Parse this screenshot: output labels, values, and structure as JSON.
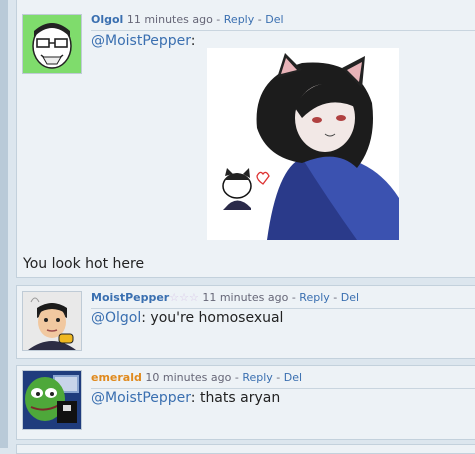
{
  "comments": [
    {
      "user": "Olgol",
      "user_color": "#3a6fb0",
      "time": "11 minutes ago",
      "sep1": " - ",
      "reply": "Reply",
      "sep2": " - ",
      "del": "Del",
      "mention": "@MoistPepper",
      "text": ":",
      "body_below": "You look hot here"
    },
    {
      "user": "MoistPepper",
      "user_color": "#3a6fb0",
      "user_suffix": "☆☆☆",
      "time": "11 minutes ago",
      "sep1": " - ",
      "reply": "Reply",
      "sep2": " - ",
      "del": "Del",
      "mention": "@Olgol",
      "text": ": you're homosexual"
    },
    {
      "user": "emerald",
      "user_color": "#e08a1e",
      "time": "10 minutes ago",
      "sep1": " - ",
      "reply": "Reply",
      "sep2": " - ",
      "del": "Del",
      "mention": "@MoistPepper",
      "text": ": thats aryan"
    }
  ]
}
